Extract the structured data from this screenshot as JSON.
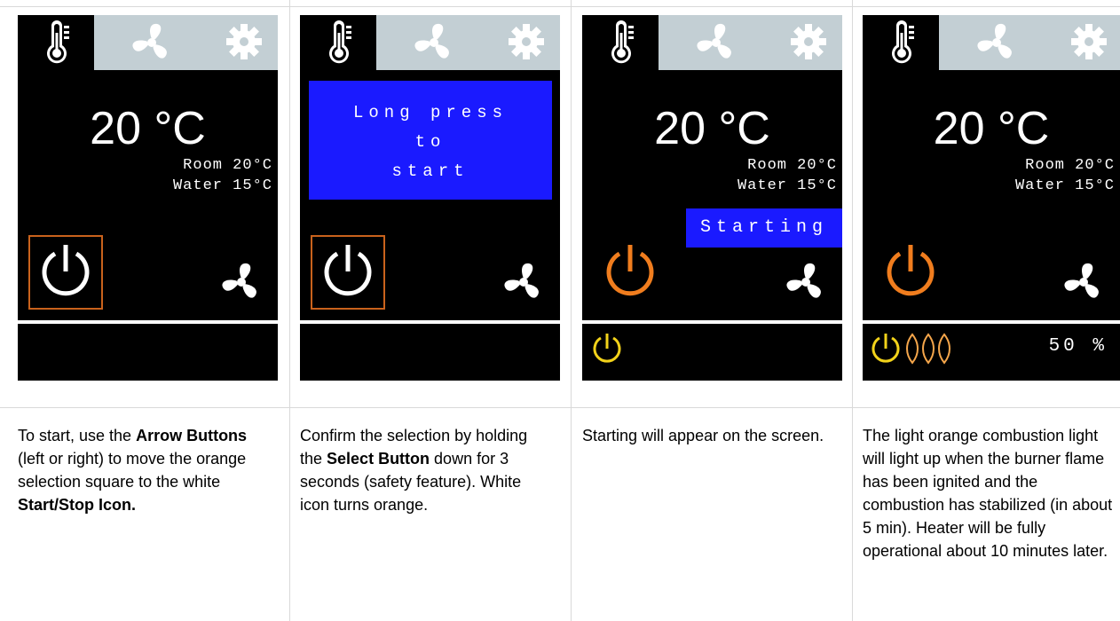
{
  "panels": [
    {
      "temp": "20 °C",
      "room": "Room 20°C",
      "water": "Water 15°C",
      "caption": {
        "t1": "To start, use the ",
        "b1": "Arrow Buttons",
        "t2": " (left or right) to move the orange selection square to the white ",
        "b2": "Start/Stop Icon.",
        "t3": ""
      }
    },
    {
      "message": [
        "Long press",
        "to",
        "start"
      ],
      "caption": {
        "t1": "Confirm the selection by holding the ",
        "b1": "Select Button",
        "t2": " down for 3 seconds (safety feature). White icon turns orange.",
        "b2": "",
        "t3": ""
      }
    },
    {
      "temp": "20 °C",
      "room": "Room 20°C",
      "water": "Water 15°C",
      "status": "Starting",
      "caption": {
        "t1": "Starting will appear on the screen.",
        "b1": "",
        "t2": "",
        "b2": "",
        "t3": ""
      }
    },
    {
      "temp": "20 °C",
      "room": "Room 20°C",
      "water": "Water 15°C",
      "percent": "50 %",
      "caption": {
        "t1": "The light orange combustion light will light up when the burner flame has been ignited and the combustion has stabilized (in about 5 min). Heater will be fully operational about 10 minutes later.",
        "b1": "",
        "t2": "",
        "b2": "",
        "t3": ""
      }
    }
  ],
  "colors": {
    "screen_bg": "#000000",
    "tab_bg": "#c3cfd4",
    "selection_orange": "#c9621c",
    "power_orange": "#f07d1e",
    "status_yellow": "#f2d21a",
    "blue": "#1a1aff"
  },
  "icons": [
    "thermometer-icon",
    "fan-icon",
    "gear-icon",
    "power-icon",
    "flame-icon"
  ]
}
